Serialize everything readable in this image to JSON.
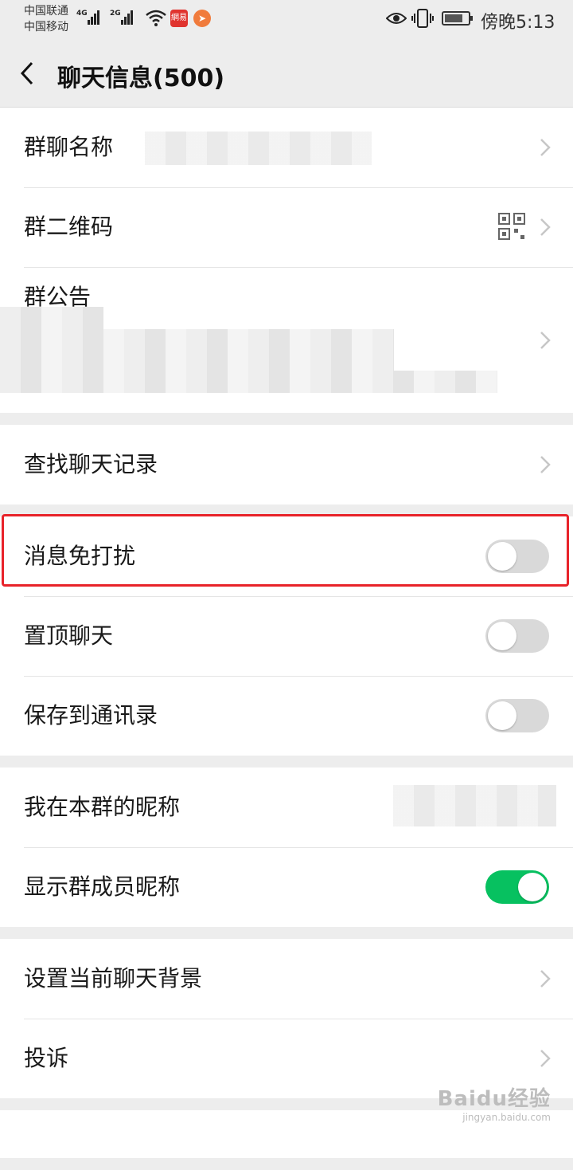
{
  "status": {
    "carrier1": "中国联通",
    "carrier2": "中国移动",
    "net1": "4G",
    "net2": "2G",
    "app1": "網易",
    "time": "傍晚5:13"
  },
  "nav": {
    "title": "聊天信息(500)"
  },
  "groups": [
    {
      "rows": [
        {
          "label": "群聊名称"
        },
        {
          "label": "群二维码"
        },
        {
          "label": "群公告"
        }
      ]
    },
    {
      "rows": [
        {
          "label": "查找聊天记录"
        }
      ]
    },
    {
      "rows": [
        {
          "label": "消息免打扰",
          "on": false
        },
        {
          "label": "置顶聊天",
          "on": false
        },
        {
          "label": "保存到通讯录",
          "on": false
        }
      ]
    },
    {
      "rows": [
        {
          "label": "我在本群的昵称"
        },
        {
          "label": "显示群成员昵称",
          "on": true
        }
      ]
    },
    {
      "rows": [
        {
          "label": "设置当前聊天背景"
        },
        {
          "label": "投诉"
        }
      ]
    }
  ],
  "colors": {
    "accent": "#07c160",
    "highlight": "#e8232a",
    "background": "#ededed"
  },
  "watermark": {
    "main": "Baidu经验",
    "sub": "jingyan.baidu.com"
  }
}
